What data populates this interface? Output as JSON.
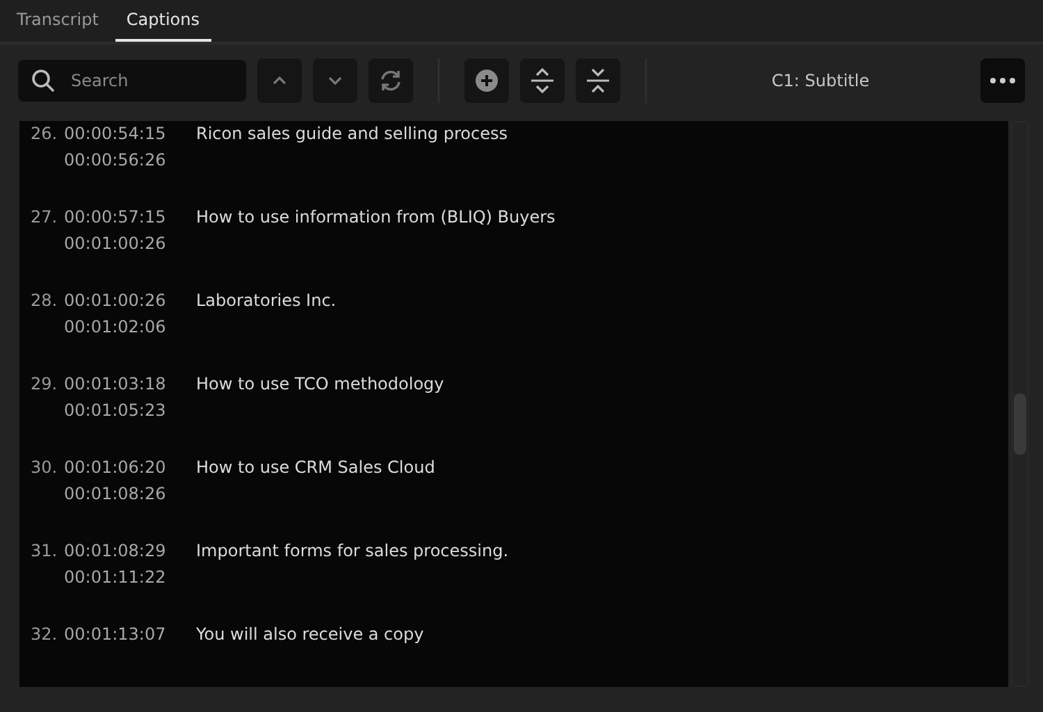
{
  "tabs": [
    {
      "label": "Transcript",
      "selected": false
    },
    {
      "label": "Captions",
      "selected": true
    }
  ],
  "search": {
    "placeholder": "Search"
  },
  "track_label": "C1: Subtitle",
  "captions": [
    {
      "index": "26.",
      "start": "00:00:54:15",
      "end": "00:00:56:26",
      "text": "Ricon sales guide and selling process"
    },
    {
      "index": "27.",
      "start": "00:00:57:15",
      "end": "00:01:00:26",
      "text": "How to use information from (BLIQ) Buyers"
    },
    {
      "index": "28.",
      "start": "00:01:00:26",
      "end": "00:01:02:06",
      "text": "Laboratories Inc."
    },
    {
      "index": "29.",
      "start": "00:01:03:18",
      "end": "00:01:05:23",
      "text": "How to use TCO methodology"
    },
    {
      "index": "30.",
      "start": "00:01:06:20",
      "end": "00:01:08:26",
      "text": "How to use CRM Sales Cloud"
    },
    {
      "index": "31.",
      "start": "00:01:08:29",
      "end": "00:01:11:22",
      "text": "Important forms for sales processing."
    },
    {
      "index": "32.",
      "start": "00:01:13:07",
      "text": "You will also receive a copy"
    }
  ]
}
